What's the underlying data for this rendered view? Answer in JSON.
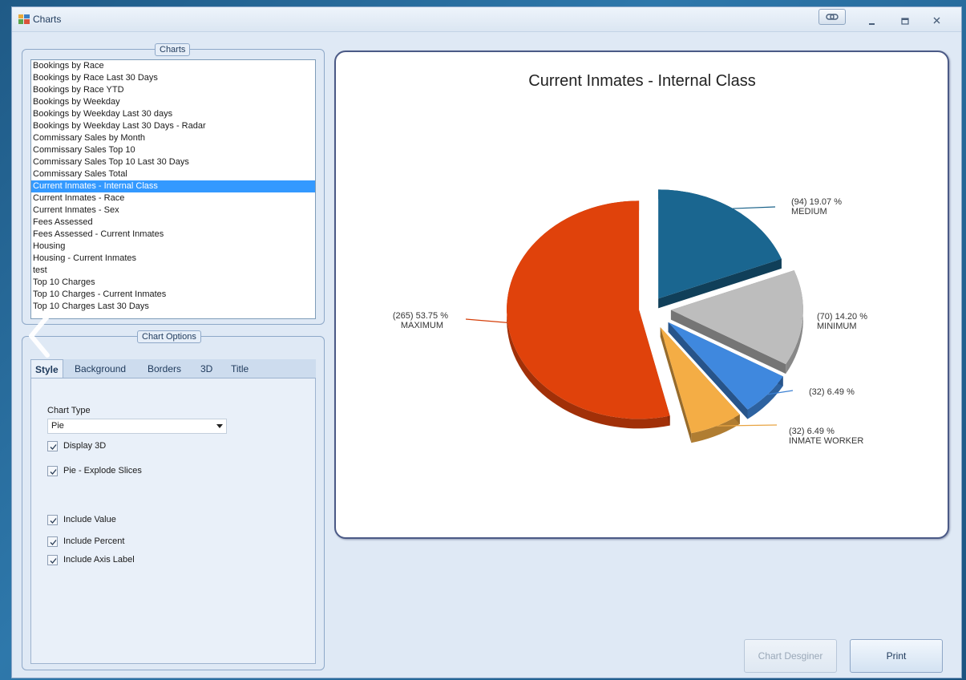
{
  "window": {
    "title": "Charts"
  },
  "charts_panel": {
    "legend": "Charts",
    "items": [
      "Bookings by Race",
      "Bookings by Race Last 30 Days",
      "Bookings by Race YTD",
      "Bookings by Weekday",
      "Bookings by Weekday Last 30 days",
      "Bookings by Weekday Last 30 Days - Radar",
      "Commissary Sales by Month",
      "Commissary Sales Top 10",
      "Commissary Sales Top 10 Last 30 Days",
      "Commissary Sales Total",
      "Current Inmates - Internal Class",
      "Current Inmates - Race",
      "Current Inmates - Sex",
      "Fees Assessed",
      "Fees Assessed - Current Inmates",
      "Housing",
      "Housing - Current Inmates",
      "test",
      "Top 10 Charges",
      "Top 10 Charges - Current Inmates",
      "Top 10 Charges Last 30 Days"
    ],
    "selected_index": 10
  },
  "options_panel": {
    "legend": "Chart Options",
    "tabs": [
      "Style",
      "Background",
      "Borders",
      "3D",
      "Title"
    ],
    "active_tab": "Style",
    "chart_type_label": "Chart Type",
    "chart_type_value": "Pie",
    "checkboxes": [
      {
        "label": "Display 3D",
        "checked": true
      },
      {
        "label": "Pie - Explode Slices",
        "checked": true
      },
      {
        "label": "Include Value",
        "checked": true
      },
      {
        "label": "Include Percent",
        "checked": true
      },
      {
        "label": "Include Axis Label",
        "checked": true
      }
    ]
  },
  "buttons": {
    "chart_designer": "Chart Desginer",
    "print": "Print"
  },
  "chart_data": {
    "type": "pie",
    "title": "Current Inmates - Internal Class",
    "three_d": true,
    "exploded": true,
    "slices": [
      {
        "label": "MEDIUM",
        "value": 94,
        "percent": 19.07,
        "value_text": "(94) 19.07 %",
        "color": "#1a6690"
      },
      {
        "label": "MINIMUM",
        "value": 70,
        "percent": 14.2,
        "value_text": "(70) 14.20 %",
        "color": "#bdbdbd"
      },
      {
        "label": "",
        "value": 32,
        "percent": 6.49,
        "value_text": "(32) 6.49 %",
        "color": "#3f88de"
      },
      {
        "label": "INMATE WORKER",
        "value": 32,
        "percent": 6.49,
        "value_text": "(32) 6.49 %",
        "color": "#f4ad45"
      },
      {
        "label": "MAXIMUM",
        "value": 265,
        "percent": 53.75,
        "value_text": "(265) 53.75 %",
        "color": "#e0420b"
      }
    ]
  }
}
